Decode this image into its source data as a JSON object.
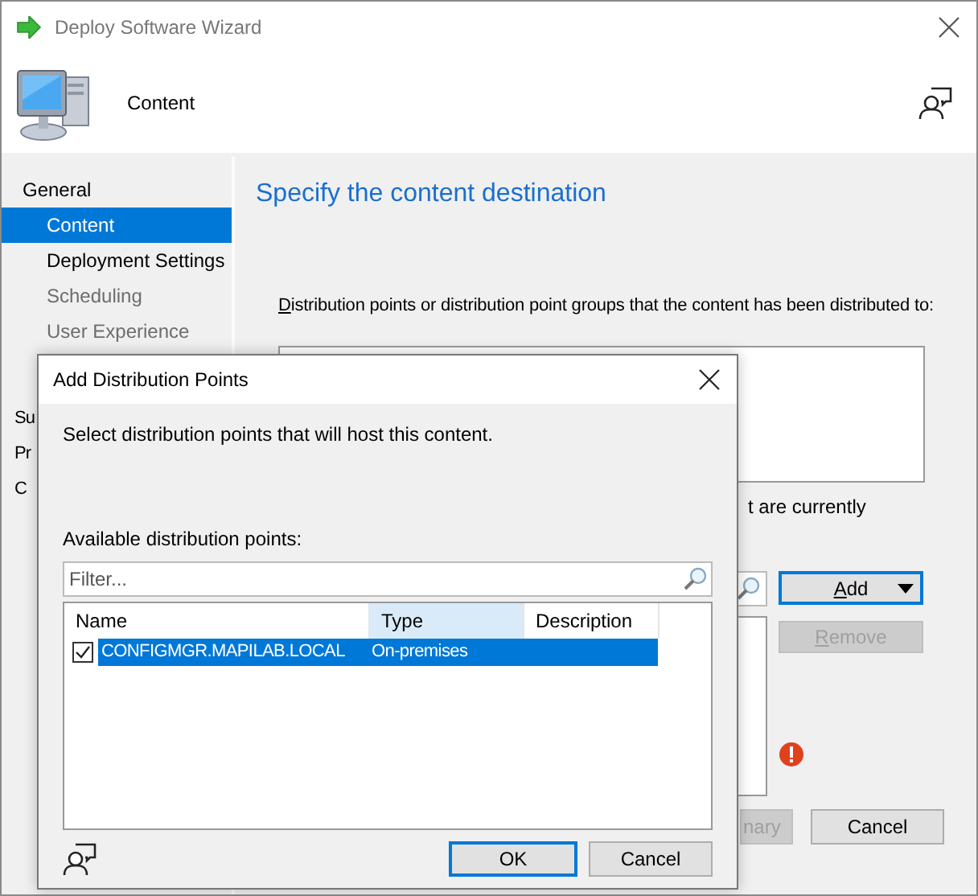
{
  "window": {
    "title": "Deploy Software Wizard"
  },
  "header": {
    "title": "Content"
  },
  "sidebar": {
    "items": [
      {
        "label": "General",
        "selected": false,
        "disabled": false,
        "children": [
          {
            "label": "Content",
            "selected": true,
            "disabled": false
          },
          {
            "label": "Deployment Settings",
            "selected": false,
            "disabled": false
          },
          {
            "label": "Scheduling",
            "selected": false,
            "disabled": true
          },
          {
            "label": "User Experience",
            "selected": false,
            "disabled": true
          }
        ]
      },
      {
        "label": "Su",
        "selected": false,
        "disabled": false
      },
      {
        "label": "Pr",
        "selected": false,
        "disabled": false
      },
      {
        "label": "C",
        "selected": false,
        "disabled": false
      }
    ]
  },
  "page": {
    "heading": "Specify the content destination",
    "distributed_label": "Distribution points or distribution point groups that the content has been distributed to:",
    "distributed_label_access_key": true,
    "note_fragment": "t are currently",
    "buttons": [
      {
        "label": "Add",
        "kind": "dropdown",
        "disabled": false,
        "default": true,
        "access_key": true
      },
      {
        "label": "Remove",
        "kind": "plain",
        "disabled": true,
        "default": false,
        "access_key": true
      }
    ],
    "error": true
  },
  "footer": {
    "buttons": [
      {
        "label": "nary",
        "disabled": true
      },
      {
        "label": "Cancel",
        "disabled": false
      }
    ]
  },
  "dialog": {
    "title": "Add Distribution Points",
    "instruction": "Select distribution points that will host this content.",
    "list_label": "Available distribution points:",
    "filter": {
      "placeholder": "Filter..."
    },
    "columns": [
      {
        "label": "Name",
        "sorted": false
      },
      {
        "label": "Type",
        "sorted": true
      },
      {
        "label": "Description",
        "sorted": false
      }
    ],
    "rows": [
      {
        "cells": [
          "CONFIGMGR.MAPILAB.LOCAL",
          "On-premises",
          ""
        ],
        "checked": true,
        "selected": true
      }
    ],
    "buttons": [
      {
        "label": "OK",
        "default": true
      },
      {
        "label": "Cancel",
        "default": false
      }
    ]
  }
}
